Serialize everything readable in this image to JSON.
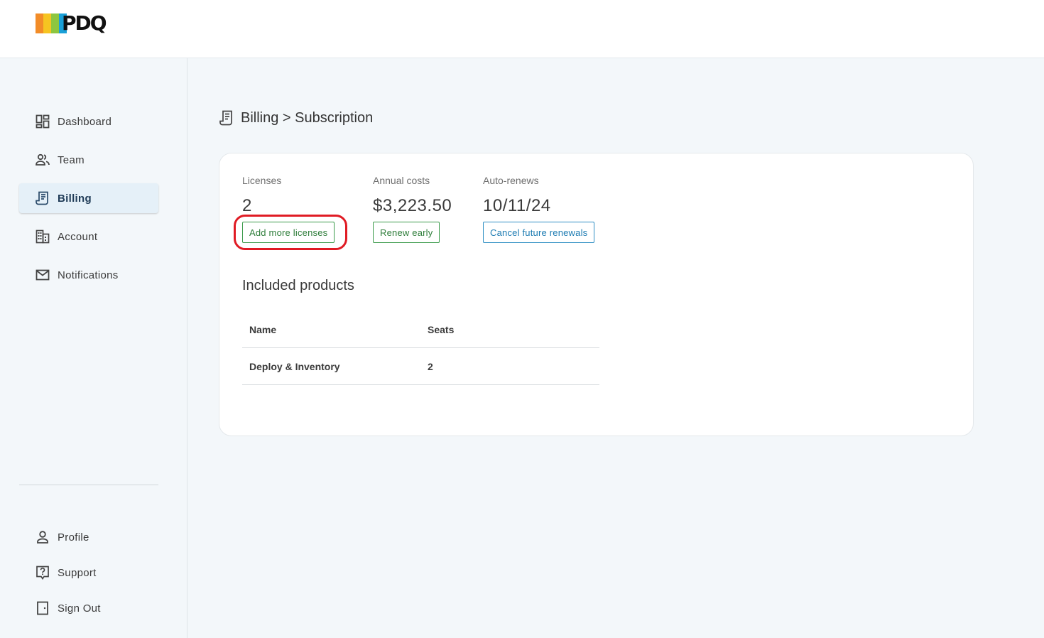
{
  "brand": {
    "name": "PDQ",
    "stripe_colors": [
      "#f28c28",
      "#f6c421",
      "#8dc63f",
      "#1aa0d8"
    ]
  },
  "sidebar": {
    "items": [
      {
        "label": "Dashboard",
        "icon": "dashboard-icon"
      },
      {
        "label": "Team",
        "icon": "team-icon"
      },
      {
        "label": "Billing",
        "icon": "billing-icon",
        "active": true
      },
      {
        "label": "Account",
        "icon": "building-icon"
      },
      {
        "label": "Notifications",
        "icon": "mail-icon"
      }
    ],
    "bottom_items": [
      {
        "label": "Profile",
        "icon": "person-icon"
      },
      {
        "label": "Support",
        "icon": "help-icon"
      },
      {
        "label": "Sign Out",
        "icon": "door-icon"
      }
    ]
  },
  "page": {
    "breadcrumb": "Billing > Subscription"
  },
  "subscription": {
    "licenses_label": "Licenses",
    "licenses_value": "2",
    "annual_label": "Annual costs",
    "annual_value": "$3,223.50",
    "renews_label": "Auto-renews",
    "renews_value": "10/11/24",
    "add_licenses_label": "Add more licenses",
    "renew_early_label": "Renew early",
    "cancel_renewals_label": "Cancel future renewals"
  },
  "products": {
    "title": "Included products",
    "columns": [
      "Name",
      "Seats"
    ],
    "rows": [
      [
        "Deploy & Inventory",
        "2"
      ]
    ]
  },
  "colors": {
    "accent_green": "#2e7d3a",
    "accent_blue": "#1c7bb2",
    "highlight": "#e01b24"
  }
}
